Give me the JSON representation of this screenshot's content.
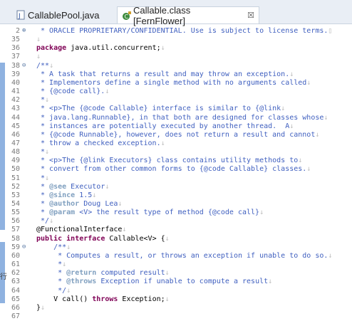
{
  "tabs": [
    {
      "label": "CallablePool.java",
      "active": false
    },
    {
      "label": "Callable.class [FernFlower]",
      "active": true,
      "close": "☒"
    }
  ],
  "lines": [
    {
      "num": "2",
      "fold": "⊕",
      "parts": [
        {
          "t": " * ORACLE PROPRIETARY/CONFIDENTIAL. Use is subject to license terms.",
          "c": "cm"
        },
        {
          "t": "▯",
          "c": "ws"
        }
      ]
    },
    {
      "num": "35",
      "parts": [
        {
          "t": "↓",
          "c": "ws"
        }
      ]
    },
    {
      "num": "36",
      "parts": [
        {
          "t": "package",
          "c": "kw"
        },
        {
          "t": " java.util.concurrent;"
        },
        {
          "t": "↓",
          "c": "ws"
        }
      ]
    },
    {
      "num": "37",
      "parts": [
        {
          "t": "↓",
          "c": "ws"
        }
      ]
    },
    {
      "num": "38",
      "fold": "⊖",
      "parts": [
        {
          "t": "/**",
          "c": "cm"
        },
        {
          "t": "↓",
          "c": "ws"
        }
      ]
    },
    {
      "num": "39",
      "parts": [
        {
          "t": " * A task that returns a result and may throw an exception.",
          "c": "cm"
        },
        {
          "t": "↓",
          "c": "ws"
        }
      ]
    },
    {
      "num": "40",
      "parts": [
        {
          "t": " * Implementors define a single method with no arguments called",
          "c": "cm"
        },
        {
          "t": "↓",
          "c": "ws"
        }
      ]
    },
    {
      "num": "41",
      "parts": [
        {
          "t": " * {@code call}.",
          "c": "cm"
        },
        {
          "t": "↓",
          "c": "ws"
        }
      ]
    },
    {
      "num": "42",
      "parts": [
        {
          "t": " *",
          "c": "cm"
        },
        {
          "t": "↓",
          "c": "ws"
        }
      ]
    },
    {
      "num": "43",
      "parts": [
        {
          "t": " * <p>The {@code Callable} interface is similar to {@link",
          "c": "cm"
        },
        {
          "t": "↓",
          "c": "ws"
        }
      ]
    },
    {
      "num": "44",
      "parts": [
        {
          "t": " * java.lang.Runnable}, in that both are designed for classes whose",
          "c": "cm"
        },
        {
          "t": "↓",
          "c": "ws"
        }
      ]
    },
    {
      "num": "45",
      "parts": [
        {
          "t": " * instances are potentially executed by another thread.  A",
          "c": "cm"
        },
        {
          "t": "↓",
          "c": "ws"
        }
      ]
    },
    {
      "num": "46",
      "parts": [
        {
          "t": " * {@code Runnable}, however, does not return a result and cannot",
          "c": "cm"
        },
        {
          "t": "↓",
          "c": "ws"
        }
      ]
    },
    {
      "num": "47",
      "parts": [
        {
          "t": " * throw a checked exception.",
          "c": "cm"
        },
        {
          "t": "↓",
          "c": "ws"
        }
      ]
    },
    {
      "num": "48",
      "parts": [
        {
          "t": " *",
          "c": "cm"
        },
        {
          "t": "↓",
          "c": "ws"
        }
      ]
    },
    {
      "num": "49",
      "parts": [
        {
          "t": " * <p>The {@link Executors} class contains utility methods to",
          "c": "cm"
        },
        {
          "t": "↓",
          "c": "ws"
        }
      ]
    },
    {
      "num": "50",
      "parts": [
        {
          "t": " * convert from other common forms to {@code Callable} classes.",
          "c": "cm"
        },
        {
          "t": "↓",
          "c": "ws"
        }
      ]
    },
    {
      "num": "51",
      "parts": [
        {
          "t": " *",
          "c": "cm"
        },
        {
          "t": "↓",
          "c": "ws"
        }
      ]
    },
    {
      "num": "52",
      "parts": [
        {
          "t": " * ",
          "c": "cm"
        },
        {
          "t": "@see",
          "c": "tag"
        },
        {
          "t": " Executor",
          "c": "cm"
        },
        {
          "t": "↓",
          "c": "ws"
        }
      ]
    },
    {
      "num": "53",
      "parts": [
        {
          "t": " * ",
          "c": "cm"
        },
        {
          "t": "@since",
          "c": "tag"
        },
        {
          "t": " 1.5",
          "c": "cm"
        },
        {
          "t": "↓",
          "c": "ws"
        }
      ]
    },
    {
      "num": "54",
      "parts": [
        {
          "t": " * ",
          "c": "cm"
        },
        {
          "t": "@author",
          "c": "tag"
        },
        {
          "t": " Doug Lea",
          "c": "cm"
        },
        {
          "t": "↓",
          "c": "ws"
        }
      ]
    },
    {
      "num": "55",
      "parts": [
        {
          "t": " * ",
          "c": "cm"
        },
        {
          "t": "@param",
          "c": "tag"
        },
        {
          "t": " <V> the result type of method {@code call}",
          "c": "cm"
        },
        {
          "t": "↓",
          "c": "ws"
        }
      ]
    },
    {
      "num": "56",
      "parts": [
        {
          "t": " */",
          "c": "cm"
        },
        {
          "t": "↓",
          "c": "ws"
        }
      ]
    },
    {
      "num": "57",
      "parts": [
        {
          "t": "@FunctionalInterface"
        },
        {
          "t": "↓",
          "c": "ws"
        }
      ]
    },
    {
      "num": "58",
      "parts": [
        {
          "t": "public",
          "c": "kw"
        },
        {
          "t": " "
        },
        {
          "t": "interface",
          "c": "kw"
        },
        {
          "t": " Callable<V> {"
        },
        {
          "t": "↓",
          "c": "ws"
        }
      ]
    },
    {
      "num": "59",
      "fold": "⊖",
      "parts": [
        {
          "t": "    /**",
          "c": "cm"
        },
        {
          "t": "↓",
          "c": "ws"
        }
      ]
    },
    {
      "num": "60",
      "parts": [
        {
          "t": "     * Computes a result, or throws an exception if unable to do so.",
          "c": "cm"
        },
        {
          "t": "↓",
          "c": "ws"
        }
      ]
    },
    {
      "num": "61",
      "parts": [
        {
          "t": "     *",
          "c": "cm"
        },
        {
          "t": "↓",
          "c": "ws"
        }
      ]
    },
    {
      "num": "62",
      "parts": [
        {
          "t": "     * ",
          "c": "cm"
        },
        {
          "t": "@return",
          "c": "tag"
        },
        {
          "t": " computed result",
          "c": "cm"
        },
        {
          "t": "↓",
          "c": "ws"
        }
      ]
    },
    {
      "num": "63",
      "parts": [
        {
          "t": "     * ",
          "c": "cm"
        },
        {
          "t": "@throws",
          "c": "tag"
        },
        {
          "t": " Exception if unable to compute a result",
          "c": "cm"
        },
        {
          "t": "↓",
          "c": "ws"
        }
      ]
    },
    {
      "num": "64",
      "parts": [
        {
          "t": "     */",
          "c": "cm"
        },
        {
          "t": "↓",
          "c": "ws"
        }
      ]
    },
    {
      "num": "65",
      "parts": [
        {
          "t": "    V call() "
        },
        {
          "t": "throws",
          "c": "kw"
        },
        {
          "t": " Exception;"
        },
        {
          "t": "↓",
          "c": "ws"
        }
      ]
    },
    {
      "num": "66",
      "parts": [
        {
          "t": "}"
        },
        {
          "t": "↓",
          "c": "ws"
        }
      ]
    },
    {
      "num": "67",
      "parts": []
    }
  ],
  "left_edge_char": "行"
}
